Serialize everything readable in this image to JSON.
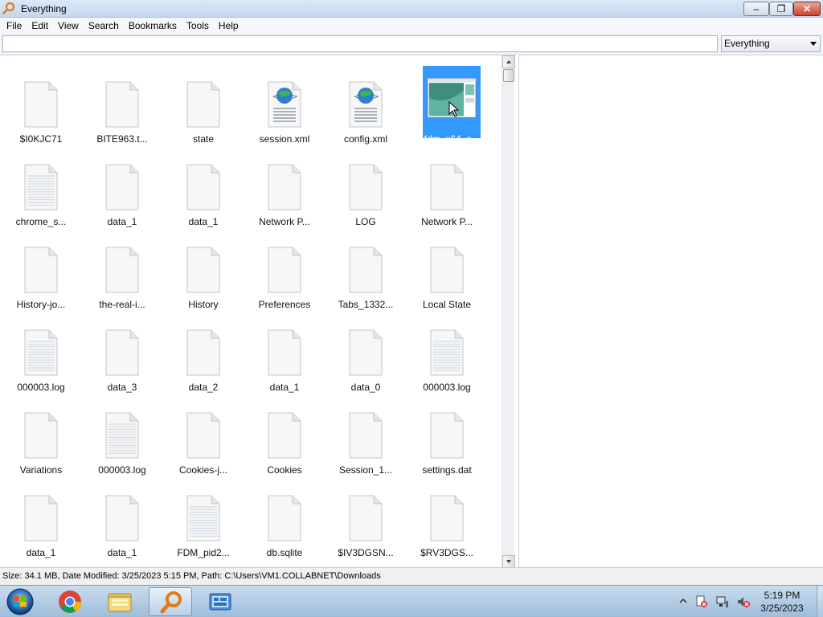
{
  "window": {
    "title": "Everything",
    "controls": {
      "minimize": "‒",
      "maximize": "❐",
      "close": "✕"
    }
  },
  "menu": [
    "File",
    "Edit",
    "View",
    "Search",
    "Bookmarks",
    "Tools",
    "Help"
  ],
  "search": {
    "value": "",
    "placeholder": "",
    "filter": "Everything"
  },
  "files": [
    {
      "name": "$I0KJC71",
      "icon": "blank-file-icon"
    },
    {
      "name": "BITE963.t...",
      "icon": "blank-file-icon"
    },
    {
      "name": "state",
      "icon": "blank-file-icon"
    },
    {
      "name": "session.xml",
      "icon": "xml-file-icon"
    },
    {
      "name": "config.xml",
      "icon": "xml-file-icon"
    },
    {
      "name": "fdm_x64_s...",
      "icon": "installer-file-icon",
      "selected": true
    },
    {
      "name": "chrome_s...",
      "icon": "text-file-icon"
    },
    {
      "name": "data_1",
      "icon": "blank-file-icon"
    },
    {
      "name": "data_1",
      "icon": "blank-file-icon"
    },
    {
      "name": "Network P...",
      "icon": "blank-file-icon"
    },
    {
      "name": "LOG",
      "icon": "blank-file-icon"
    },
    {
      "name": "Network P...",
      "icon": "blank-file-icon"
    },
    {
      "name": "History-jo...",
      "icon": "blank-file-icon"
    },
    {
      "name": "the-real-i...",
      "icon": "blank-file-icon"
    },
    {
      "name": "History",
      "icon": "blank-file-icon"
    },
    {
      "name": "Preferences",
      "icon": "blank-file-icon"
    },
    {
      "name": "Tabs_1332...",
      "icon": "blank-file-icon"
    },
    {
      "name": "Local State",
      "icon": "blank-file-icon"
    },
    {
      "name": "000003.log",
      "icon": "text-file-icon"
    },
    {
      "name": "data_3",
      "icon": "blank-file-icon"
    },
    {
      "name": "data_2",
      "icon": "blank-file-icon"
    },
    {
      "name": "data_1",
      "icon": "blank-file-icon"
    },
    {
      "name": "data_0",
      "icon": "blank-file-icon"
    },
    {
      "name": "000003.log",
      "icon": "text-file-icon"
    },
    {
      "name": "Variations",
      "icon": "blank-file-icon"
    },
    {
      "name": "000003.log",
      "icon": "text-file-icon"
    },
    {
      "name": "Cookies-j...",
      "icon": "blank-file-icon"
    },
    {
      "name": "Cookies",
      "icon": "blank-file-icon"
    },
    {
      "name": "Session_1...",
      "icon": "blank-file-icon"
    },
    {
      "name": "settings.dat",
      "icon": "blank-file-icon"
    },
    {
      "name": "data_1",
      "icon": "blank-file-icon"
    },
    {
      "name": "data_1",
      "icon": "blank-file-icon"
    },
    {
      "name": "FDM_pid2...",
      "icon": "text-file-icon"
    },
    {
      "name": "db.sqlite",
      "icon": "blank-file-icon"
    },
    {
      "name": "$IV3DGSN...",
      "icon": "blank-file-icon"
    },
    {
      "name": "$RV3DGS...",
      "icon": "blank-file-icon"
    }
  ],
  "status": "Size: 34.1 MB, Date Modified: 3/25/2023 5:15 PM, Path: C:\\Users\\VM1.COLLABNET\\Downloads",
  "taskbar": {
    "apps": [
      {
        "name": "chrome",
        "icon": "chrome-icon"
      },
      {
        "name": "explorer",
        "icon": "folder-icon"
      },
      {
        "name": "everything",
        "icon": "magnifier-icon",
        "active": true
      },
      {
        "name": "control-panel",
        "icon": "control-panel-icon"
      }
    ],
    "clock": {
      "time": "5:19 PM",
      "date": "3/25/2023"
    }
  },
  "colors": {
    "selection": "#3399ff",
    "titlebar": "#c5d7ee",
    "taskbar": "#9fbcd9"
  }
}
